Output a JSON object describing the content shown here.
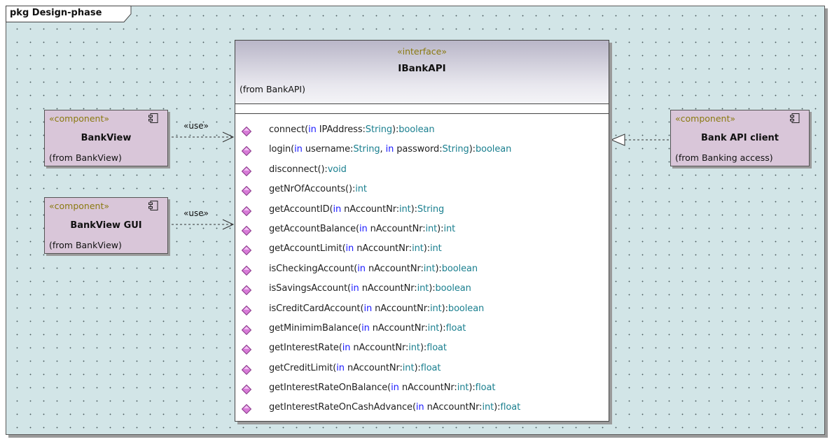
{
  "package": {
    "label": "pkg Design-phase"
  },
  "components": [
    {
      "stereotype": "«component»",
      "name": "BankView",
      "from": "(from BankView)"
    },
    {
      "stereotype": "«component»",
      "name": "BankView GUI",
      "from": "(from BankView)"
    },
    {
      "stereotype": "«component»",
      "name": "Bank API client",
      "from": "(from Banking access)"
    }
  ],
  "dependencies": [
    {
      "label": "«use»"
    },
    {
      "label": "«use»"
    }
  ],
  "interface": {
    "stereotype": "«interface»",
    "name": "IBankAPI",
    "from": "(from BankAPI)",
    "operations": [
      {
        "name": "connect",
        "params": [
          {
            "dir": "in",
            "name": "IPAddress",
            "type": "String"
          }
        ],
        "ret": "boolean"
      },
      {
        "name": "login",
        "params": [
          {
            "dir": "in",
            "name": "username",
            "type": "String"
          },
          {
            "dir": "in",
            "name": "password",
            "type": "String"
          }
        ],
        "ret": "boolean"
      },
      {
        "name": "disconnect",
        "params": [],
        "ret": "void"
      },
      {
        "name": "getNrOfAccounts",
        "params": [],
        "ret": "int"
      },
      {
        "name": "getAccountID",
        "params": [
          {
            "dir": "in",
            "name": "nAccountNr",
            "type": "int"
          }
        ],
        "ret": "String"
      },
      {
        "name": "getAccountBalance",
        "params": [
          {
            "dir": "in",
            "name": "nAccountNr",
            "type": "int"
          }
        ],
        "ret": "int"
      },
      {
        "name": "getAccountLimit",
        "params": [
          {
            "dir": "in",
            "name": "nAccountNr",
            "type": "int"
          }
        ],
        "ret": "int"
      },
      {
        "name": "isCheckingAccount",
        "params": [
          {
            "dir": "in",
            "name": "nAccountNr",
            "type": "int"
          }
        ],
        "ret": "boolean"
      },
      {
        "name": "isSavingsAccount",
        "params": [
          {
            "dir": "in",
            "name": "nAccountNr",
            "type": "int"
          }
        ],
        "ret": "boolean"
      },
      {
        "name": "isCreditCardAccount",
        "params": [
          {
            "dir": "in",
            "name": "nAccountNr",
            "type": "int"
          }
        ],
        "ret": "boolean"
      },
      {
        "name": "getMinimimBalance",
        "params": [
          {
            "dir": "in",
            "name": "nAccountNr",
            "type": "int"
          }
        ],
        "ret": "float"
      },
      {
        "name": "getInterestRate",
        "params": [
          {
            "dir": "in",
            "name": "nAccountNr",
            "type": "int"
          }
        ],
        "ret": "float"
      },
      {
        "name": "getCreditLimit",
        "params": [
          {
            "dir": "in",
            "name": "nAccountNr",
            "type": "int"
          }
        ],
        "ret": "float"
      },
      {
        "name": "getInterestRateOnBalance",
        "params": [
          {
            "dir": "in",
            "name": "nAccountNr",
            "type": "int"
          }
        ],
        "ret": "float"
      },
      {
        "name": "getInterestRateOnCashAdvance",
        "params": [
          {
            "dir": "in",
            "name": "nAccountNr",
            "type": "int"
          }
        ],
        "ret": "float"
      }
    ]
  },
  "colors": {
    "background": "#d2e5e7",
    "component_fill": "#d9c6d9",
    "stereotype_text": "#8a7a10",
    "keyword": "#1a1aff",
    "type": "#1a7f8f",
    "operation_icon": "#d77bd7"
  },
  "icons": {
    "component": "component-icon",
    "operation": "operation-diamond-icon"
  }
}
